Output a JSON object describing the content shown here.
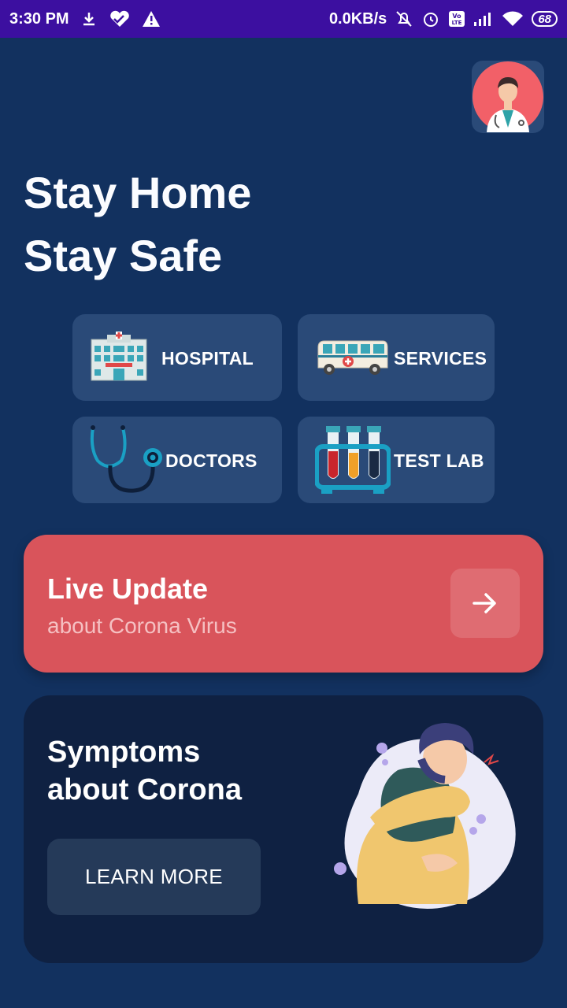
{
  "status_bar": {
    "time": "3:30 PM",
    "network_speed": "0.0KB/s",
    "battery": "68",
    "icons": [
      "download-icon",
      "health-heart-icon",
      "warning-icon",
      "alarm-off-icon",
      "alarm-icon",
      "volte-icon",
      "signal-icon",
      "wifi-icon",
      "battery-icon"
    ]
  },
  "header": {
    "avatar_icon": "doctor-avatar-icon"
  },
  "headline": {
    "line1": "Stay Home",
    "line2": "Stay Safe"
  },
  "tiles": [
    {
      "label": "HOSPITAL",
      "icon": "hospital-icon"
    },
    {
      "label": "SERVICES",
      "icon": "ambulance-icon"
    },
    {
      "label": "DOCTORS",
      "icon": "stethoscope-icon"
    },
    {
      "label": "TEST LAB",
      "icon": "test-tubes-icon"
    }
  ],
  "live_update": {
    "title": "Live Update",
    "subtitle": "about Corona Virus",
    "arrow_icon": "arrow-right-icon"
  },
  "symptoms": {
    "title_line1": "Symptoms",
    "title_line2": "about Corona",
    "button_label": "LEARN MORE",
    "illustration": "coughing-person-illustration"
  },
  "colors": {
    "background": "#12315f",
    "status_bar": "#3c0fa0",
    "tile": "#2a4a78",
    "live_card": "#d9545b",
    "symptoms_card": "#0f2142",
    "learn_button": "#253a59"
  }
}
